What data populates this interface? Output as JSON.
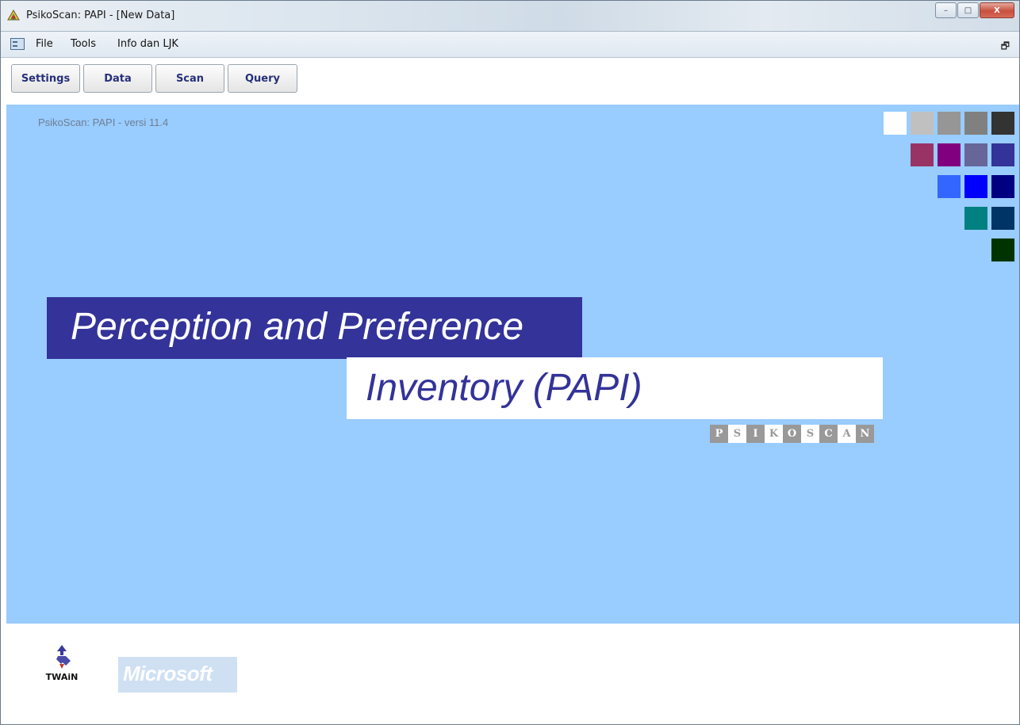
{
  "window": {
    "title": "PsikoScan: PAPI - [New Data]",
    "controls": {
      "minimize": "–",
      "maximize": "□",
      "close": "X"
    }
  },
  "menu": {
    "items": [
      "File",
      "Tools",
      "Info dan LJK"
    ],
    "restore_glyph": "🗗"
  },
  "toolbar": {
    "buttons": [
      "Settings",
      "Data",
      "Scan",
      "Query"
    ]
  },
  "main": {
    "background": "#99ccff",
    "version": "PsikoScan: PAPI - versi 11.4",
    "title_line1": "Perception and Preference",
    "title_line2": "Inventory (PAPI)",
    "brand_letters": [
      "P",
      "S",
      "I",
      "K",
      "O",
      "S",
      "C",
      "A",
      "N"
    ],
    "palette_rows": [
      [
        "#ffffff",
        "#c0c0c0",
        "#969696",
        "#808080",
        "#333333"
      ],
      [
        "#993366",
        "#800080",
        "#666699",
        "#333399"
      ],
      [
        "#3366ff",
        "#0000ff",
        "#000080"
      ],
      [
        "#008080",
        "#003366"
      ],
      [
        "#003300"
      ]
    ]
  },
  "footer": {
    "twain_label": "TWAiN",
    "microsoft_label": "Microsoft"
  }
}
